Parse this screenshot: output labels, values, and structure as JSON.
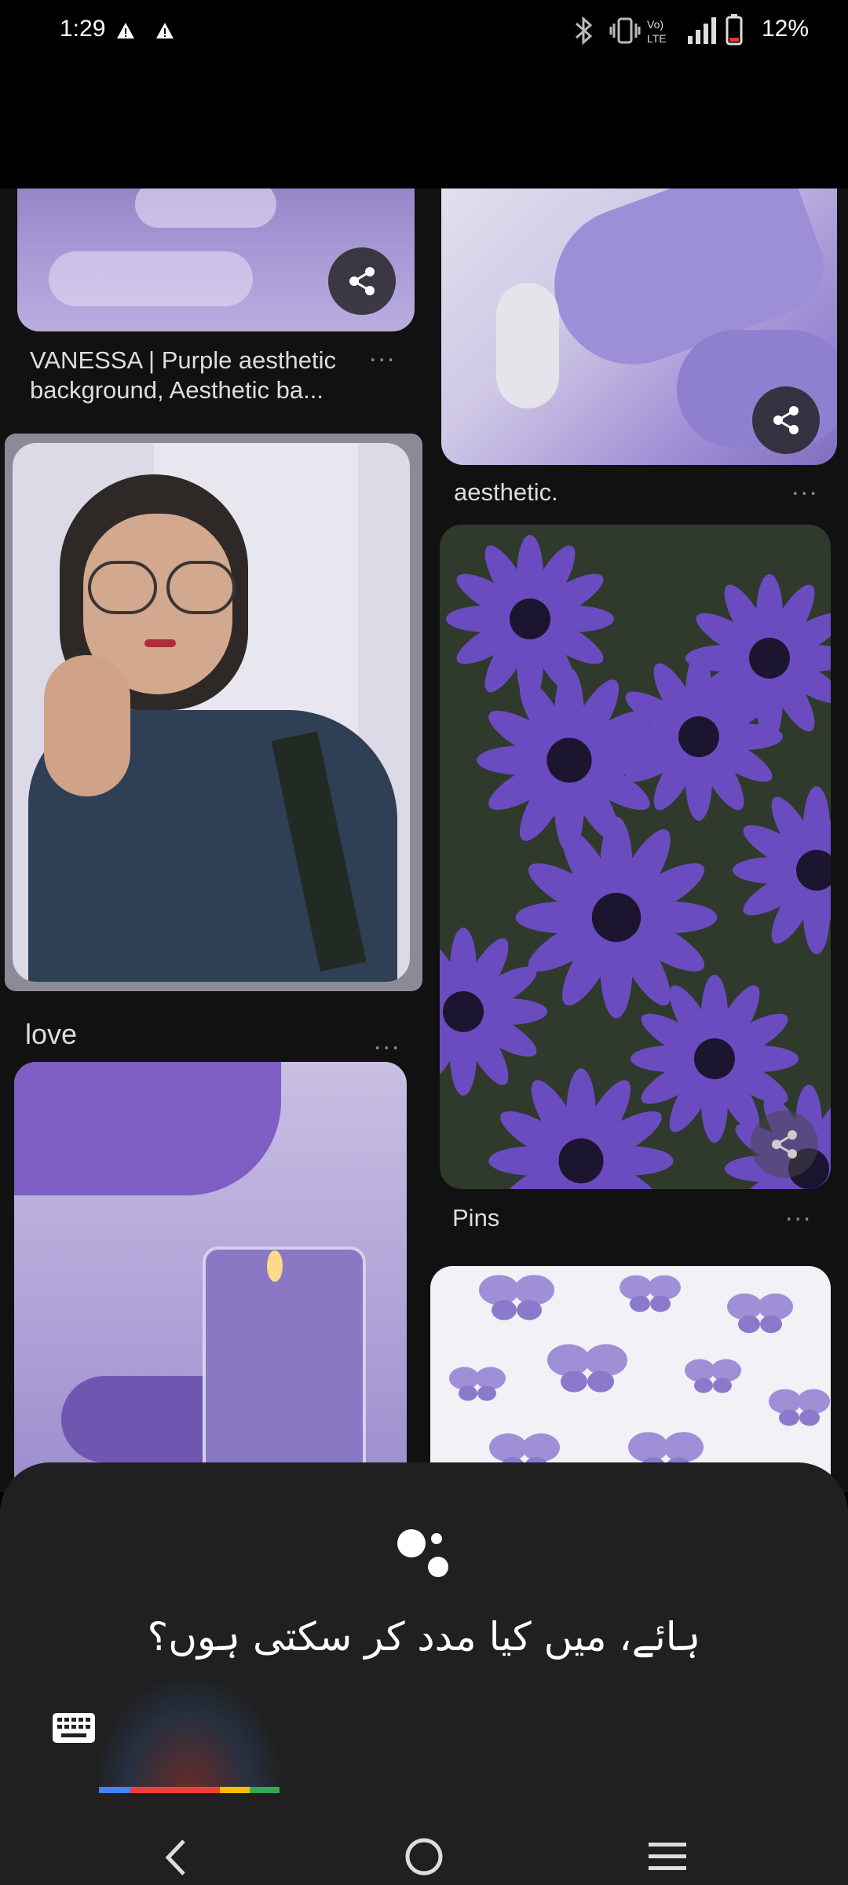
{
  "status_bar": {
    "time": "1:29",
    "battery": "12%",
    "icons": [
      "warning-icon",
      "warning-icon",
      "bluetooth-icon",
      "vibrate-icon",
      "volte-icon",
      "signal-icon",
      "battery-icon"
    ]
  },
  "pins": [
    {
      "title": "VANESSA | Purple aesthetic background, Aesthetic ba...",
      "more": "..."
    },
    {
      "title": "aesthetic.",
      "more": "..."
    },
    {
      "title": "love",
      "more": "..."
    },
    {
      "title": "Pins",
      "more": "..."
    }
  ],
  "assistant": {
    "prompt": "ہائے، میں کیا مدد کر سکتی ہوں؟",
    "colors": [
      "#4285F4",
      "#EA4335",
      "#FBBC05",
      "#34A853"
    ]
  },
  "nav": {
    "icons": [
      "back-icon",
      "home-icon",
      "recents-icon"
    ]
  }
}
